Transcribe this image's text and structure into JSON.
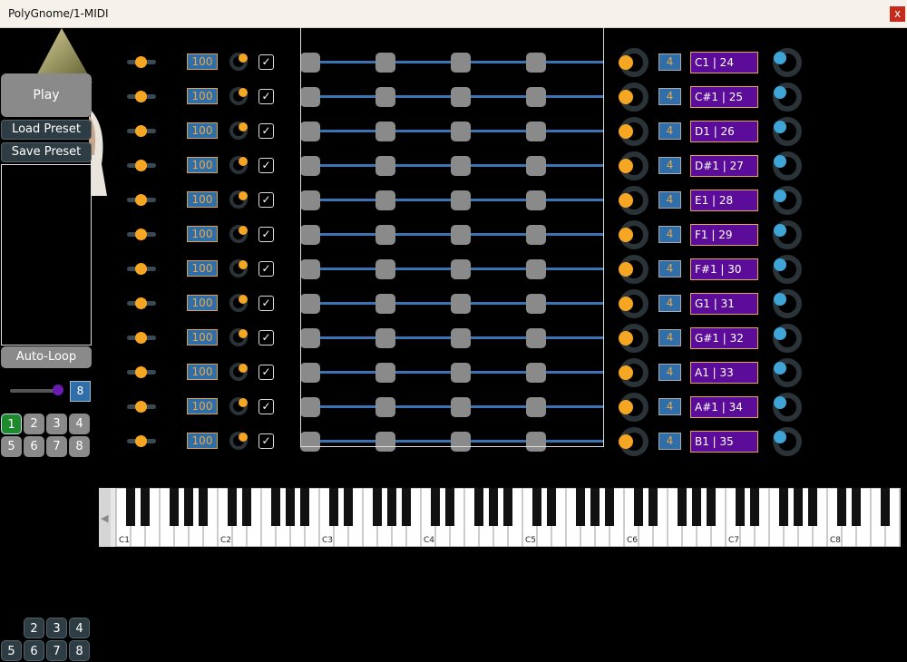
{
  "window": {
    "title": "PolyGnome/1-MIDI",
    "close_label": "x"
  },
  "left": {
    "play_label": "Play",
    "load_label": "Load Preset",
    "save_label": "Save Preset",
    "autoloop_label": "Auto-Loop",
    "loop_count": "8",
    "pads_top": [
      "1",
      "2",
      "3",
      "4",
      "5",
      "6",
      "7",
      "8"
    ],
    "active_pad": 1,
    "pads_bottom": [
      "2",
      "3",
      "4",
      "5",
      "6",
      "7",
      "8"
    ]
  },
  "rows": [
    {
      "velocity": "100",
      "checked": true,
      "div": "4",
      "note": "C1 | 24"
    },
    {
      "velocity": "100",
      "checked": true,
      "div": "4",
      "note": "C#1 | 25"
    },
    {
      "velocity": "100",
      "checked": true,
      "div": "4",
      "note": "D1 | 26"
    },
    {
      "velocity": "100",
      "checked": true,
      "div": "4",
      "note": "D#1 | 27"
    },
    {
      "velocity": "100",
      "checked": true,
      "div": "4",
      "note": "E1 | 28"
    },
    {
      "velocity": "100",
      "checked": true,
      "div": "4",
      "note": "F1 | 29"
    },
    {
      "velocity": "100",
      "checked": true,
      "div": "4",
      "note": "F#1 | 30"
    },
    {
      "velocity": "100",
      "checked": true,
      "div": "4",
      "note": "G1 | 31"
    },
    {
      "velocity": "100",
      "checked": true,
      "div": "4",
      "note": "G#1 | 32"
    },
    {
      "velocity": "100",
      "checked": true,
      "div": "4",
      "note": "A1 | 33"
    },
    {
      "velocity": "100",
      "checked": true,
      "div": "4",
      "note": "A#1 | 34"
    },
    {
      "velocity": "100",
      "checked": true,
      "div": "4",
      "note": "B1 | 35"
    }
  ],
  "steps_per_row": 4,
  "check_glyph": "✓",
  "keyboard": {
    "octave_labels": [
      "C1",
      "C2",
      "C3",
      "C4",
      "C5",
      "C6",
      "C7",
      "C8"
    ],
    "scroll_arrow": "◀"
  },
  "colors": {
    "accent_orange": "#f5a623",
    "accent_blue": "#3fa5d6",
    "note_purple": "#5b0d99",
    "active_green": "#1f8a2d",
    "lane_blue": "#3b74b5"
  }
}
